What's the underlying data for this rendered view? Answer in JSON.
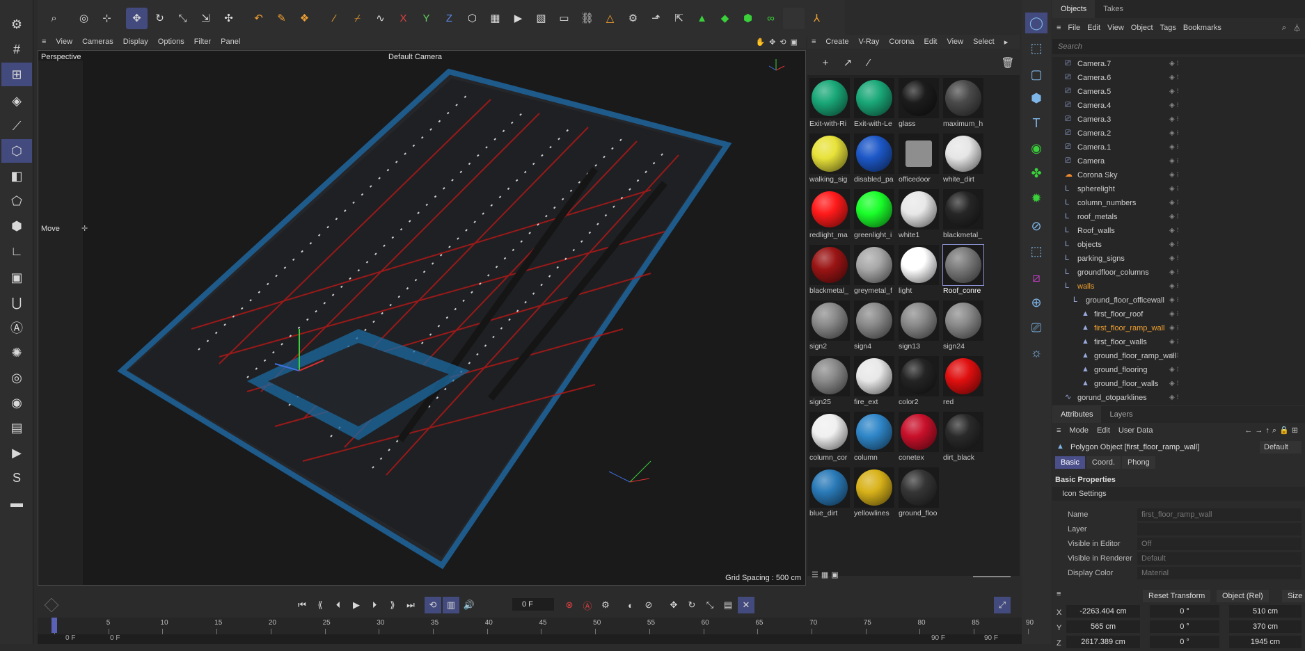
{
  "top_toolbar": {
    "icons": [
      "search-icon",
      "live-select-icon",
      "select-plus-icon",
      "move-icon",
      "rotate-icon",
      "scale-icon",
      "move-axis-icon",
      "transform-icon",
      "bend-icon",
      "pen-icon",
      "paint-icon",
      "brush-icon",
      "knife-icon",
      "spline-icon",
      "x-axis-icon",
      "y-axis-icon",
      "z-axis-icon",
      "world-coordinate-icon",
      "render-view-icon",
      "render-picture-queue-icon",
      "render-settings-icon",
      "render-region-icon",
      "link-icon",
      "warning-icon",
      "gear-icon",
      "arrow-up-icon",
      "landscape-icon",
      "cube-green-icon",
      "cube-green2-icon",
      "deformer-icon",
      "blank-icon",
      "figure-icon"
    ],
    "axis_labels": {
      "x": "X",
      "y": "Y",
      "z": "Z"
    }
  },
  "viewport": {
    "menu": [
      "View",
      "Cameras",
      "Display",
      "Options",
      "Filter",
      "Panel"
    ],
    "label": "Perspective",
    "camera": "Default Camera",
    "grid_spacing": "Grid Spacing : 500 cm",
    "move_label": "Move"
  },
  "material_manager": {
    "menu": [
      "Create",
      "V-Ray",
      "Corona",
      "Edit",
      "View",
      "Select"
    ],
    "materials": [
      {
        "name": "Exit-with-Ri",
        "color": "#1aa878",
        "kind": "exit"
      },
      {
        "name": "Exit-with-Le",
        "color": "#1aa878",
        "kind": "exit"
      },
      {
        "name": "glass",
        "color": "#1c1c1c",
        "kind": "sphere"
      },
      {
        "name": "maximum_h",
        "color": "#4a4a4a",
        "kind": "sphere"
      },
      {
        "name": "walking_sig",
        "color": "#e8e23a",
        "kind": "sphere"
      },
      {
        "name": "disabled_pa",
        "color": "#1d58c8",
        "kind": "sphere"
      },
      {
        "name": "officedoor",
        "color": "#8e8e8e",
        "kind": "box"
      },
      {
        "name": "white_dirt",
        "color": "#e6e6e6",
        "kind": "sphere"
      },
      {
        "name": "redlight_ma",
        "color": "#ff1a1a",
        "kind": "sphere"
      },
      {
        "name": "greenlight_i",
        "color": "#1aff2a",
        "kind": "sphere"
      },
      {
        "name": "white1",
        "color": "#e8e8e8",
        "kind": "sphere"
      },
      {
        "name": "blackmetal_",
        "color": "#262626",
        "kind": "sphere"
      },
      {
        "name": "blackmetal_",
        "color": "#9a1414",
        "kind": "sphere"
      },
      {
        "name": "greymetal_f",
        "color": "#a8a8a8",
        "kind": "sphere"
      },
      {
        "name": "light",
        "color": "#ffffff",
        "kind": "sphere"
      },
      {
        "name": "Roof_conre",
        "color": "#7a7a7a",
        "kind": "sphere",
        "selected": true
      },
      {
        "name": "sign2",
        "color": "#8a8a8a",
        "kind": "sphere"
      },
      {
        "name": "sign4",
        "color": "#8a8a8a",
        "kind": "sphere"
      },
      {
        "name": "sign13",
        "color": "#8a8a8a",
        "kind": "sphere"
      },
      {
        "name": "sign24",
        "color": "#8a8a8a",
        "kind": "sphere"
      },
      {
        "name": "sign25",
        "color": "#8a8a8a",
        "kind": "sphere"
      },
      {
        "name": "fire_ext",
        "color": "#e8e8e8",
        "kind": "sphere"
      },
      {
        "name": "color2",
        "color": "#242424",
        "kind": "sphere"
      },
      {
        "name": "red",
        "color": "#e00f0f",
        "kind": "sphere"
      },
      {
        "name": "column_cor",
        "color": "#f0f0f0",
        "kind": "sphere"
      },
      {
        "name": "column",
        "color": "#2f86c8",
        "kind": "sphere"
      },
      {
        "name": "conetex",
        "color": "#c8102a",
        "kind": "sphere"
      },
      {
        "name": "dirt_black",
        "color": "#2a2a2a",
        "kind": "sphere"
      },
      {
        "name": "blue_dirt",
        "color": "#2a7ab8",
        "kind": "sphere"
      },
      {
        "name": "yellowlines",
        "color": "#d8b21a",
        "kind": "sphere"
      },
      {
        "name": "ground_floo",
        "color": "#353535",
        "kind": "sphere"
      }
    ]
  },
  "objects_panel": {
    "tabs": [
      "Objects",
      "Takes"
    ],
    "menu": [
      "File",
      "Edit",
      "View",
      "Object",
      "Tags",
      "Bookmarks"
    ],
    "search_placeholder": "Search",
    "rows": [
      {
        "name": "Camera.7",
        "indent": 0,
        "icon": "camera-icon"
      },
      {
        "name": "Camera.6",
        "indent": 0,
        "icon": "camera-icon"
      },
      {
        "name": "Camera.5",
        "indent": 0,
        "icon": "camera-icon"
      },
      {
        "name": "Camera.4",
        "indent": 0,
        "icon": "camera-icon"
      },
      {
        "name": "Camera.3",
        "indent": 0,
        "icon": "camera-icon"
      },
      {
        "name": "Camera.2",
        "indent": 0,
        "icon": "camera-icon"
      },
      {
        "name": "Camera.1",
        "indent": 0,
        "icon": "camera-icon"
      },
      {
        "name": "Camera",
        "indent": 0,
        "icon": "camera-icon"
      },
      {
        "name": "Corona Sky",
        "indent": 0,
        "icon": "sky-icon"
      },
      {
        "name": "spherelight",
        "indent": 0,
        "icon": "null-icon"
      },
      {
        "name": "column_numbers",
        "indent": 0,
        "icon": "null-icon"
      },
      {
        "name": "roof_metals",
        "indent": 0,
        "icon": "null-icon"
      },
      {
        "name": "Roof_walls",
        "indent": 0,
        "icon": "null-icon"
      },
      {
        "name": "objects",
        "indent": 0,
        "icon": "null-icon"
      },
      {
        "name": "parking_signs",
        "indent": 0,
        "icon": "null-icon"
      },
      {
        "name": "groundfloor_columns",
        "indent": 0,
        "icon": "null-icon"
      },
      {
        "name": "walls",
        "indent": 0,
        "icon": "null-icon",
        "highlight": true
      },
      {
        "name": "ground_floor_officewall",
        "indent": 1,
        "icon": "null-icon"
      },
      {
        "name": "first_floor_roof",
        "indent": 2,
        "icon": "polygon-icon"
      },
      {
        "name": "first_floor_ramp_wall",
        "indent": 2,
        "icon": "polygon-icon",
        "highlight": true
      },
      {
        "name": "first_floor_walls",
        "indent": 2,
        "icon": "polygon-icon"
      },
      {
        "name": "ground_floor_ramp_wall",
        "indent": 2,
        "icon": "polygon-icon"
      },
      {
        "name": "ground_flooring",
        "indent": 2,
        "icon": "polygon-icon"
      },
      {
        "name": "ground_floor_walls",
        "indent": 2,
        "icon": "polygon-icon"
      },
      {
        "name": "gorund_otoparklines",
        "indent": 0,
        "icon": "spline-icon"
      }
    ]
  },
  "attributes": {
    "tabs": [
      "Attributes",
      "Layers"
    ],
    "menu": [
      "Mode",
      "Edit",
      "User Data"
    ],
    "object_title": "Polygon Object [first_floor_ramp_wall]",
    "preset": "Default",
    "subtabs": [
      "Basic",
      "Coord.",
      "Phong"
    ],
    "section": "Basic Properties",
    "icon_settings": "Icon Settings",
    "props": [
      {
        "label": "Name",
        "value": "first_floor_ramp_wall"
      },
      {
        "label": "Layer",
        "value": ""
      },
      {
        "label": "Visible in Editor",
        "value": "Off"
      },
      {
        "label": "Visible in Renderer",
        "value": "Default"
      },
      {
        "label": "Display Color",
        "value": "Material"
      }
    ]
  },
  "coordinates": {
    "reset_label": "Reset Transform",
    "mode": "Object (Rel)",
    "size_label": "Size",
    "rows": [
      {
        "axis": "X",
        "pos": "-2263.404 cm",
        "rot": "0 °",
        "size": "510 cm"
      },
      {
        "axis": "Y",
        "pos": "565 cm",
        "rot": "0 °",
        "size": "370 cm"
      },
      {
        "axis": "Z",
        "pos": "2617.389 cm",
        "rot": "0 °",
        "size": "1945 cm"
      }
    ]
  },
  "timeline": {
    "current_frame": "0 F",
    "ticks": [
      "0",
      "5",
      "10",
      "15",
      "20",
      "25",
      "30",
      "35",
      "40",
      "45",
      "50",
      "55",
      "60",
      "65",
      "70",
      "75",
      "80",
      "85",
      "90"
    ],
    "start": "0 F",
    "start2": "0 F",
    "end": "90 F",
    "end2": "90 F"
  },
  "colors": {
    "accent": "#434a7d",
    "highlight_orange": "#f0a030",
    "panel_bg": "#2b2b2b",
    "viewport_bg": "#1a1a1a"
  }
}
